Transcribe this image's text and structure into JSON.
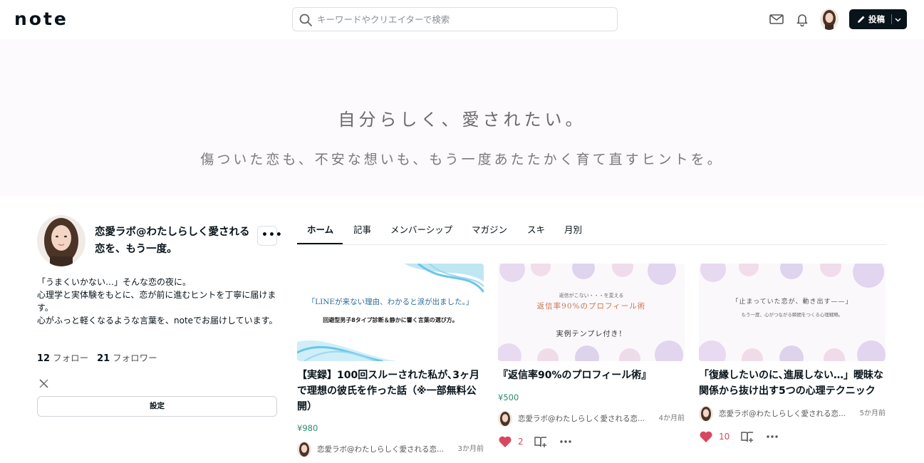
{
  "header": {
    "logo": "note",
    "search_placeholder": "キーワードやクリエイターで検索",
    "post_label": "投稿"
  },
  "hero": {
    "title": "自分らしく、愛されたい。",
    "subtitle": "傷ついた恋も、不安な想いも、もう一度あたたかく育て直すヒントを。"
  },
  "profile": {
    "name": "恋愛ラボ@わたしらしく愛される恋を、もう一度。",
    "bio": [
      "「うまくいかない…」そんな恋の夜に。",
      "心理学と実体験をもとに、恋が前に進むヒントを丁寧に届けます。",
      "心がふっと軽くなるような言葉を、noteでお届けしています。"
    ],
    "follow_count": "12",
    "follow_label": "フォロー",
    "follower_count": "21",
    "follower_label": "フォロワー",
    "settings_label": "設定"
  },
  "tabs": [
    "ホーム",
    "記事",
    "メンバーシップ",
    "マガジン",
    "スキ",
    "月別"
  ],
  "cards": [
    {
      "thumb_line1": "「LINEが来ない理由、わかると涙が出ました。」",
      "thumb_line2": "回避型男子8タイプ診断＆静かに響く言葉の選び方。",
      "title": "【実録】100回スルーされた私が､3ヶ月で理想の彼氏を作った話（※一部無料公開）",
      "price": "¥980",
      "author": "恋愛ラボ@わたしらしく愛される恋...",
      "date": "3か月前"
    },
    {
      "thumb_line1": "返信がこない・・・を変える",
      "thumb_line2": "返信率90%のプロフィール術",
      "thumb_line3": "実例テンプレ付き！",
      "title": "『返信率90%のプロフィール術』",
      "price": "¥500",
      "author": "恋愛ラボ@わたしらしく愛される恋...",
      "date": "4か月前",
      "likes": "2"
    },
    {
      "thumb_line1": "「止まっていた恋が、動き出す——」",
      "thumb_line2": "もう一度、心がつながる瞬間をつくる心理戦略。",
      "title": "「復縁したいのに､進展しない…」曖昧な関係から抜け出す5つの心理テクニック",
      "author": "恋愛ラボ@わたしらしく愛される恋...",
      "date": "5か月前",
      "likes": "10"
    }
  ],
  "colors": {
    "brand_dark": "#08131a",
    "price_green": "#2c8a6a",
    "like_red": "#d8475e"
  }
}
